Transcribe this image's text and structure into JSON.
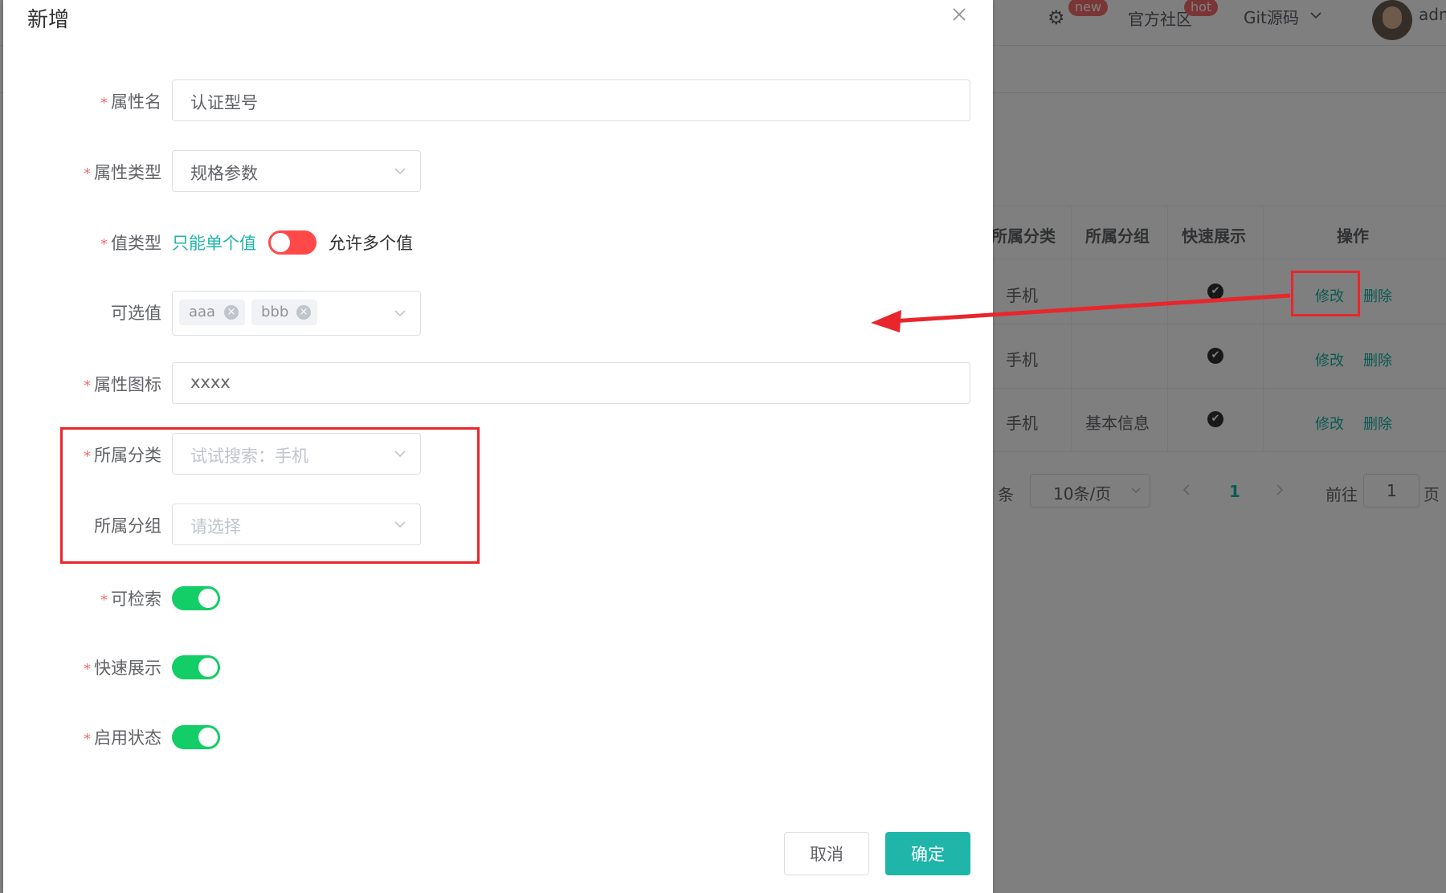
{
  "header": {
    "badge_new": "new",
    "community": "官方社区",
    "badge_hot": "hot",
    "git_source": "Git源码",
    "user": "adm"
  },
  "table": {
    "columns": [
      "所属分类",
      "所属分组",
      "快速展示",
      "操作"
    ],
    "rows": [
      {
        "category": "手机",
        "group": "",
        "edit": "修改",
        "delete": "删除"
      },
      {
        "category": "手机",
        "group": "",
        "edit": "修改",
        "delete": "删除"
      },
      {
        "category": "手机",
        "group": "基本信息",
        "edit": "修改",
        "delete": "删除"
      }
    ],
    "check_glyph": "✔"
  },
  "pagination": {
    "total_suffix": "条",
    "page_size": "10条/页",
    "current": "1",
    "goto_label": "前往",
    "goto_value": "1",
    "page_suffix": "页"
  },
  "dialog": {
    "title": "新增",
    "fields": {
      "attr_name": {
        "label": "属性名",
        "value": "认证型号"
      },
      "attr_type": {
        "label": "属性类型",
        "value": "规格参数"
      },
      "value_type": {
        "label": "值类型",
        "left_text": "只能单个值",
        "right_text": "允许多个值",
        "on": false
      },
      "options": {
        "label": "可选值",
        "tags": [
          "aaa",
          "bbb"
        ]
      },
      "icon": {
        "label": "属性图标",
        "value": "xxxx"
      },
      "category": {
        "label": "所属分类",
        "placeholder": "试试搜索：手机"
      },
      "group": {
        "label": "所属分组",
        "placeholder": "请选择"
      },
      "searchable": {
        "label": "可检索",
        "on": true
      },
      "quick_show": {
        "label": "快速展示",
        "on": true
      },
      "enabled": {
        "label": "启用状态",
        "on": true
      }
    },
    "cancel": "取消",
    "confirm": "确定"
  },
  "colors": {
    "primary": "#1fb5a8",
    "switch_on": "#13ce66",
    "switch_off": "#ff4949",
    "annotation": "#e8262b"
  }
}
